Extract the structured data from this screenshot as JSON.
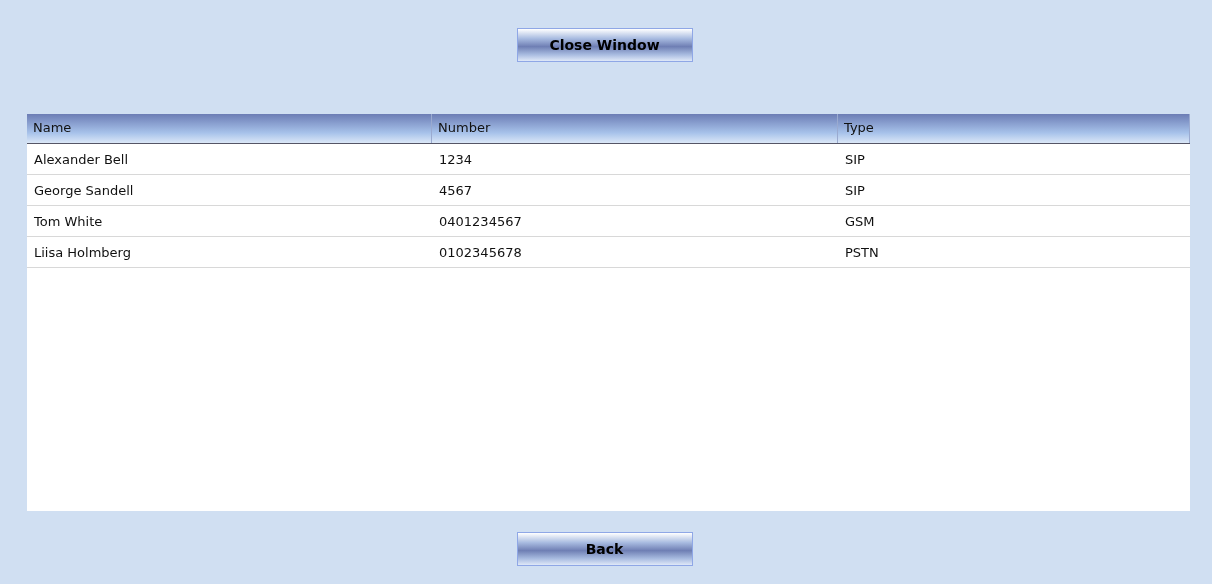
{
  "buttons_top": [
    "Close Window"
  ],
  "table": {
    "columns": [
      "Name",
      "Number",
      "Type"
    ],
    "rows": [
      [
        "Alexander Bell",
        "1234",
        "SIP"
      ],
      [
        "George Sandell",
        "4567",
        "SIP"
      ],
      [
        "Tom White",
        "0401234567",
        "GSM"
      ],
      [
        "Liisa Holmberg",
        "0102345678",
        "PSTN"
      ]
    ]
  },
  "buttons_bottom": [
    "Back"
  ]
}
